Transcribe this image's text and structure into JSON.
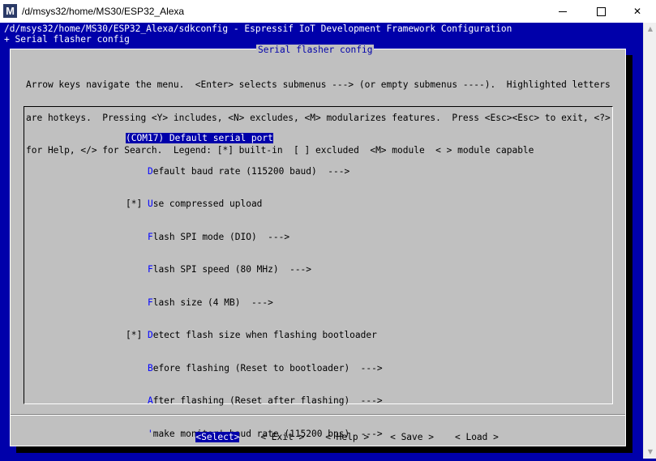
{
  "window": {
    "title": "/d/msys32/home/MS30/ESP32_Alexa",
    "icon_letter": "M",
    "controls": {
      "minimize": "minimize",
      "maximize": "maximize",
      "close": "✕"
    }
  },
  "terminal": {
    "path_line": "/d/msys32/home/MS30/ESP32_Alexa/sdkconfig - Espressif IoT Development Framework Configuration",
    "breadcrumb": "+ Serial flasher config"
  },
  "dialog": {
    "title": "Serial flasher config",
    "instructions": [
      "Arrow keys navigate the menu.  <Enter> selects submenus ---> (or empty submenus ----).  Highlighted letters",
      "are hotkeys.  Pressing <Y> includes, <N> excludes, <M> modularizes features.  Press <Esc><Esc> to exit, <?>",
      "for Help, </> for Search.  Legend: [*] built-in  [ ] excluded  <M> module  < > module capable"
    ]
  },
  "menu": {
    "items": [
      {
        "prefix": "",
        "hotkey": "(",
        "rest": "COM17) Default serial port",
        "selected": true
      },
      {
        "prefix": "    ",
        "hotkey": "D",
        "rest": "efault baud rate (115200 baud)  --->",
        "selected": false
      },
      {
        "prefix": "[*] ",
        "hotkey": "U",
        "rest": "se compressed upload",
        "selected": false
      },
      {
        "prefix": "    ",
        "hotkey": "F",
        "rest": "lash SPI mode (DIO)  --->",
        "selected": false
      },
      {
        "prefix": "    ",
        "hotkey": "F",
        "rest": "lash SPI speed (80 MHz)  --->",
        "selected": false
      },
      {
        "prefix": "    ",
        "hotkey": "F",
        "rest": "lash size (4 MB)  --->",
        "selected": false
      },
      {
        "prefix": "[*] ",
        "hotkey": "D",
        "rest": "etect flash size when flashing bootloader",
        "selected": false
      },
      {
        "prefix": "    ",
        "hotkey": "B",
        "rest": "efore flashing (Reset to bootloader)  --->",
        "selected": false
      },
      {
        "prefix": "    ",
        "hotkey": "A",
        "rest": "fter flashing (Reset after flashing)  --->",
        "selected": false
      },
      {
        "prefix": "    ",
        "hotkey": "'",
        "rest": "make monitor' baud rate (115200 bps)  --->",
        "selected": false
      }
    ]
  },
  "buttons": {
    "select": "<Select>",
    "exit": "< Exit >",
    "help": "< Help >",
    "save": "< Save >",
    "load": "< Load >"
  },
  "colors": {
    "terminal_bg": "#0000aa",
    "dialog_bg": "#c0c0c0",
    "hotkey": "#0000ff",
    "selection_bg": "#0000aa"
  }
}
